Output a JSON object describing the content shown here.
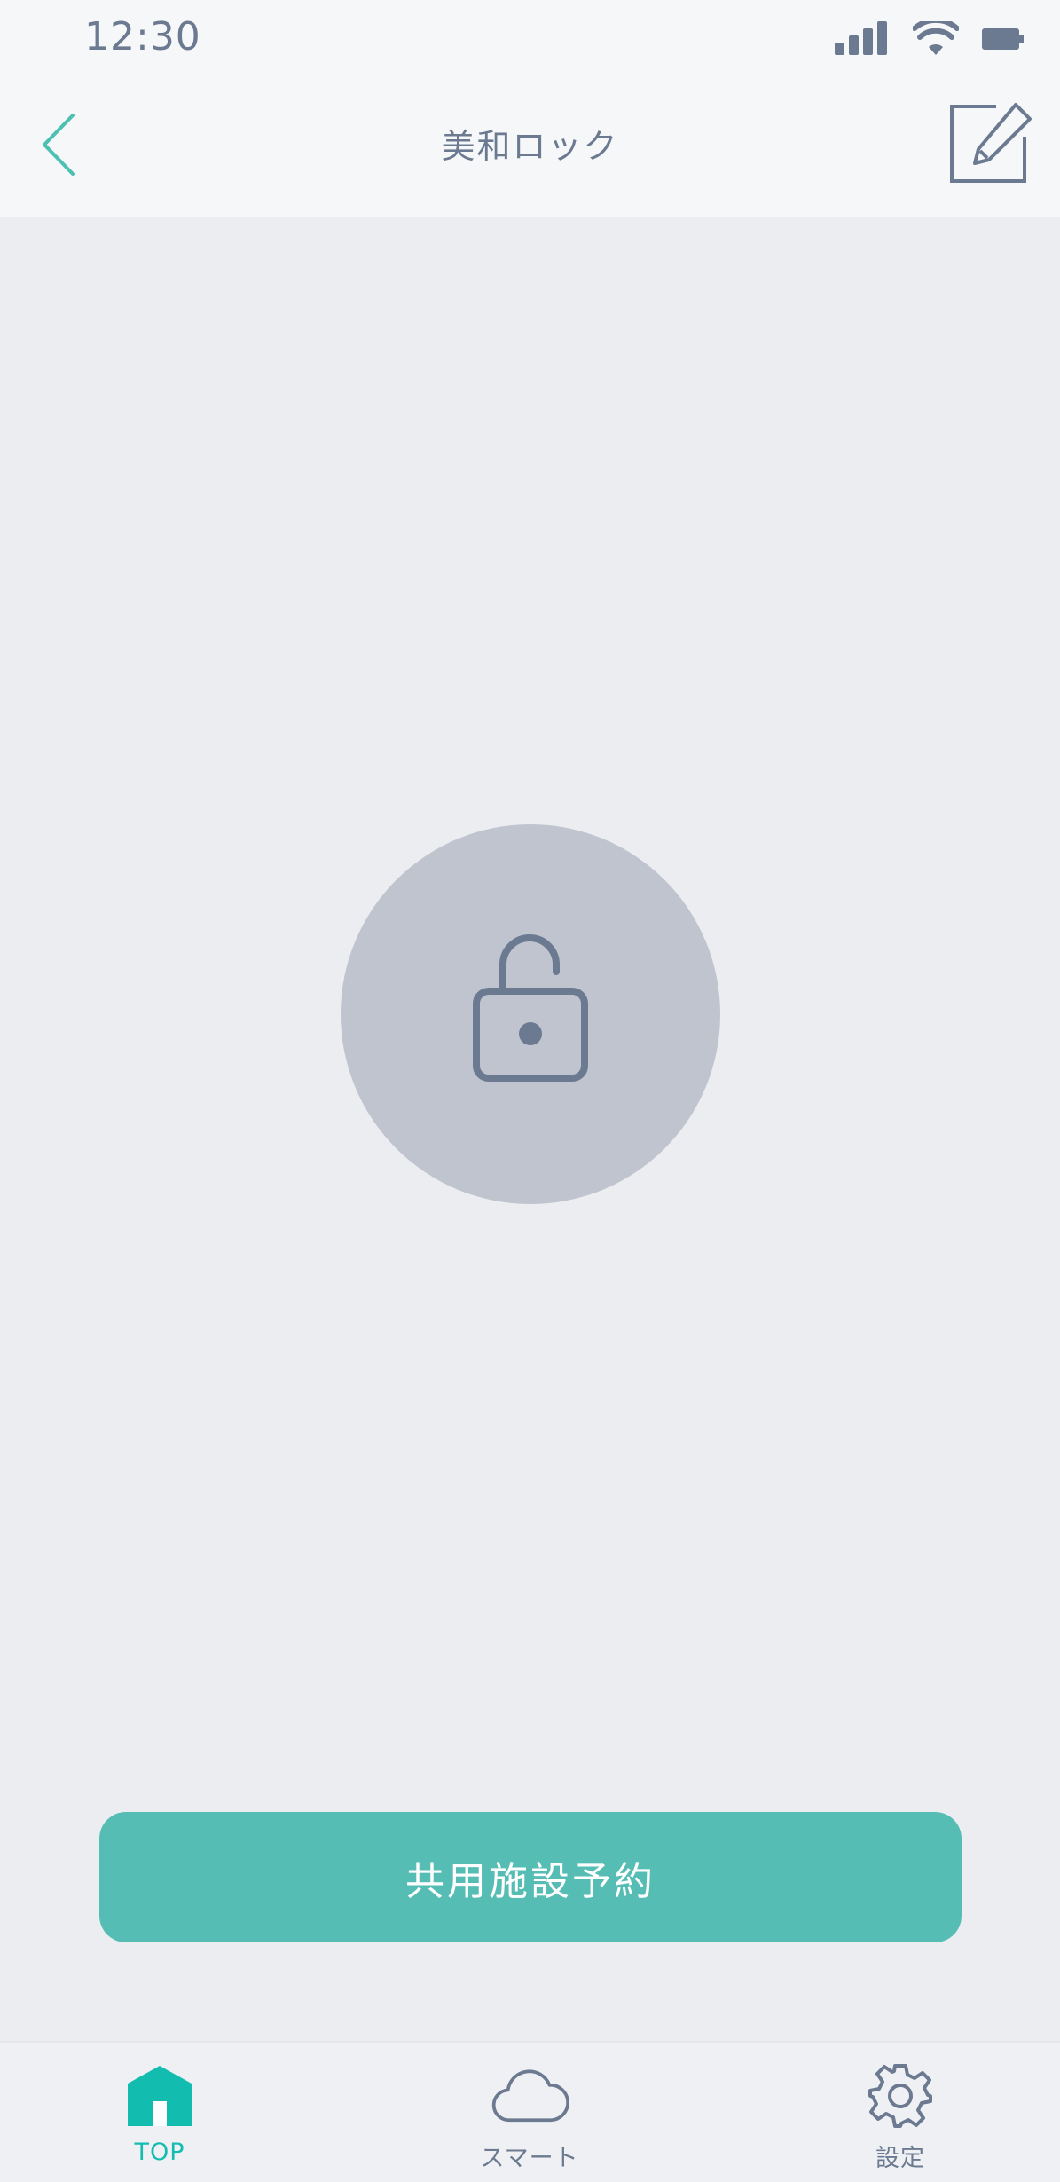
{
  "status_bar": {
    "time": "12:30",
    "icons": [
      "signal-icon",
      "wifi-icon",
      "battery-icon"
    ]
  },
  "nav": {
    "title": "美和ロック",
    "back_icon": "chevron-left-icon",
    "edit_icon": "edit-icon"
  },
  "lock": {
    "icon": "unlocked-padlock-icon",
    "state": "unlocked"
  },
  "reserve_button": {
    "label": "共用施設予約"
  },
  "tabs": [
    {
      "label": "TOP",
      "icon": "home-icon",
      "active": true
    },
    {
      "label": "スマート",
      "icon": "cloud-icon",
      "active": false
    },
    {
      "label": "設定",
      "icon": "gear-icon",
      "active": false
    }
  ],
  "colors": {
    "accent": "#12BDB0",
    "button": "#55BDB4",
    "background": "#ECEDF0",
    "header": "#F6F7F9",
    "icon_gray": "#6B7A90",
    "lock_circle": "#BFC4CF"
  }
}
